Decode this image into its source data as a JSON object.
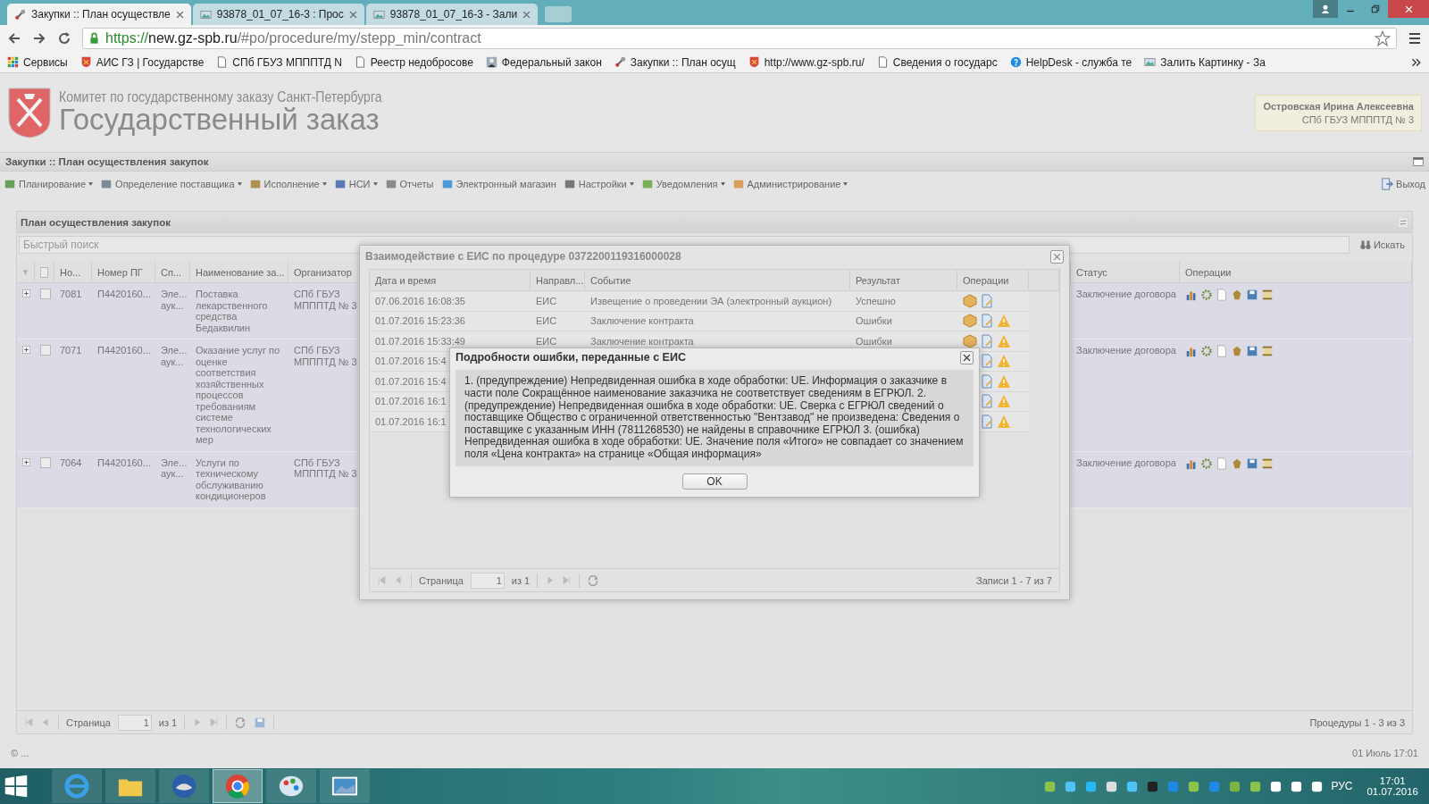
{
  "browser": {
    "tabs": [
      {
        "title": "Закупки :: План осуществле",
        "selected": true
      },
      {
        "title": "93878_01_07_16-3 : Прос",
        "selected": false
      },
      {
        "title": "93878_01_07_16-3 - Зали",
        "selected": false
      }
    ],
    "url": {
      "scheme": "https://",
      "host": "new.gz-spb.ru",
      "path": "/#po/procedure/my/stepp_min/contract"
    },
    "bookmarks": [
      {
        "label": "Сервисы",
        "kind": "apps"
      },
      {
        "label": "АИС ГЗ | Государстве",
        "kind": "crest"
      },
      {
        "label": "СПб ГБУЗ МПППТД N",
        "kind": "page"
      },
      {
        "label": "Реестр недобросове",
        "kind": "page"
      },
      {
        "label": "Федеральный закон",
        "kind": "person"
      },
      {
        "label": "Закупки :: План осущ",
        "kind": "tool"
      },
      {
        "label": "http://www.gz-spb.ru/",
        "kind": "crest"
      },
      {
        "label": "Сведения о государс",
        "kind": "page"
      },
      {
        "label": "HelpDesk - служба те",
        "kind": "help"
      },
      {
        "label": "Залить Картинку - За",
        "kind": "image"
      }
    ]
  },
  "header": {
    "organization": "Комитет по государственному заказу Санкт-Петербурга",
    "title": "Государственный заказ",
    "user_name": "Островская Ирина Алексеевна",
    "user_org": "СПб ГБУЗ МПППТД № 3"
  },
  "panel_title": "Закупки :: План осуществления закупок",
  "menu": [
    {
      "label": "Планирование",
      "dropdown": true
    },
    {
      "label": "Определение поставщика",
      "dropdown": true
    },
    {
      "label": "Исполнение",
      "dropdown": true
    },
    {
      "label": "НСИ",
      "dropdown": true
    },
    {
      "label": "Отчеты",
      "dropdown": false
    },
    {
      "label": "Электронный магазин",
      "dropdown": false
    },
    {
      "label": "Настройки",
      "dropdown": true
    },
    {
      "label": "Уведомления",
      "dropdown": true
    },
    {
      "label": "Администрирование",
      "dropdown": true
    }
  ],
  "exit": "Выход",
  "plan": {
    "title": "План осуществления закупок",
    "search": {
      "placeholder": "Быстрый поиск",
      "button": "Искать"
    },
    "columns": [
      "Но...",
      "Номер ПГ",
      "Сп...",
      "Наименование за...",
      "Организатор",
      "Статус",
      "Операции"
    ],
    "header_checked": false,
    "rows": [
      {
        "number": "7081",
        "pg": "П4420160...",
        "method": [
          "Эле...",
          "аук..."
        ],
        "name": "Поставка лекарственного средства Бедаквилин",
        "organizer": [
          "СПб ГБУЗ",
          "МПППТД № 3"
        ],
        "status": "Заключение договора",
        "checked": false
      },
      {
        "number": "7071",
        "pg": "П4420160...",
        "method": [
          "Эле...",
          "аук..."
        ],
        "name": "Оказание услуг по оценке соответствия хозяйственных процессов требованиям системе технологических мер",
        "organizer": [
          "СПб ГБУЗ",
          "МПППТД № 3"
        ],
        "status": "Заключение договора",
        "checked": false
      },
      {
        "number": "7064",
        "pg": "П4420160...",
        "method": [
          "Эле...",
          "аук..."
        ],
        "name": "Услуги по техническому обслуживанию кондиционеров",
        "organizer": [
          "СПб ГБУЗ",
          "МПППТД № 3"
        ],
        "status": "Заключение договора",
        "checked": false
      }
    ],
    "pager": {
      "page_label": "Страница",
      "page": "1",
      "of": "из 1",
      "summary": "Процедуры 1 - 3 из 3"
    }
  },
  "footer": {
    "left": "© ...",
    "right": "01 Июль 17:01"
  },
  "eis_dialog": {
    "title": "Взаимодействие с ЕИС по процедуре 0372200119316000028",
    "columns": [
      "Дата и время",
      "Направл...",
      "Событие",
      "Результат",
      "Операции"
    ],
    "rows": [
      {
        "date": "07.06.2016 16:08:35",
        "direction": "ЕИС",
        "event": "Извещение о проведении ЭА (электронный аукцион)",
        "result": "Успешно",
        "warning": false
      },
      {
        "date": "01.07.2016 15:23:36",
        "direction": "ЕИС",
        "event": "Заключение контракта",
        "result": "Ошибки",
        "warning": true
      },
      {
        "date": "01.07.2016 15:33:49",
        "direction": "ЕИС",
        "event": "Заключение контракта",
        "result": "Ошибки",
        "warning": true
      },
      {
        "date": "01.07.2016 15:4",
        "warning": true
      },
      {
        "date": "01.07.2016 15:4",
        "warning": true
      },
      {
        "date": "01.07.2016 16:1",
        "warning": true
      },
      {
        "date": "01.07.2016 16:1",
        "warning": true
      }
    ],
    "pager": {
      "page_label": "Страница",
      "page": "1",
      "of": "из 1",
      "summary": "Записи 1 - 7 из 7"
    }
  },
  "error_dialog": {
    "title": "Подробности ошибки, переданные с ЕИС",
    "message": "1. (предупреждение) Непредвиденная ошибка в ходе обработки: UE. Информация о заказчике в части поле Сокращённое наименование заказчика не соответствует сведениям в ЕГРЮЛ. 2. (предупреждение) Непредвиденная ошибка в ходе обработки: UE. Сверка с ЕГРЮЛ сведений о поставщике Общество с ограниченной ответственностью \"Вентзавод\" не произведена: Сведения о поставщике с указанным ИНН (7811268530) не найдены в справочнике ЕГРЮЛ 3. (ошибка) Непредвиденная ошибка в ходе обработки: UE. Значение поля «Итого» не совпадает со значением поля «Цена контракта» на странице «Общая информация»",
    "button": "OK"
  },
  "taskbar": {
    "apps": [
      {
        "kind": "ie",
        "selected": false
      },
      {
        "kind": "folder",
        "selected": false
      },
      {
        "kind": "mail",
        "selected": false
      },
      {
        "kind": "chrome",
        "selected": true
      },
      {
        "kind": "paint",
        "selected": false
      },
      {
        "kind": "photos",
        "selected": false
      }
    ],
    "language": "РУС",
    "time": "17:01",
    "date": "01.07.2016"
  }
}
